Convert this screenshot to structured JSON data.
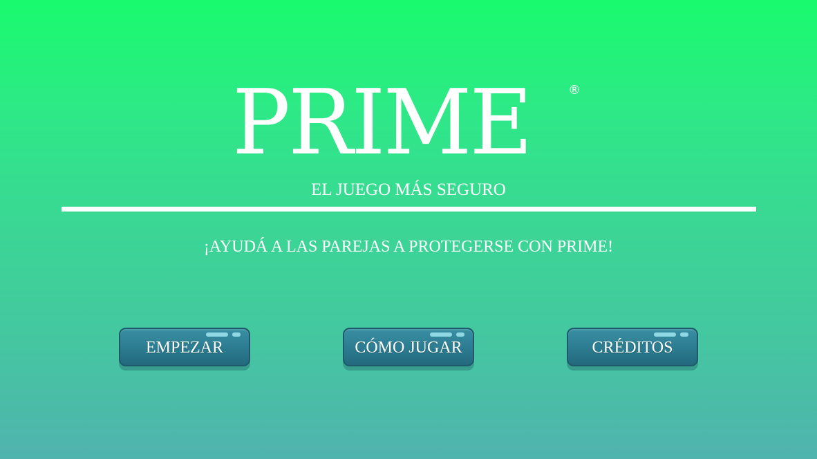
{
  "logo": {
    "text": "PRIME",
    "registered_mark": "®"
  },
  "subtitle": "EL JUEGO MÁS SEGURO",
  "tagline": "¡AYUDÁ A LAS PAREJAS A PROTEGERSE CON PRIME!",
  "menu": {
    "buttons": [
      {
        "label": "EMPEZAR"
      },
      {
        "label": "CÓMO JUGAR"
      },
      {
        "label": "CRÉDITOS"
      }
    ]
  },
  "colors": {
    "background_top": "#19fb6e",
    "background_bottom": "#50b3ae",
    "button": "#2c7b90",
    "text": "#ffffff"
  }
}
